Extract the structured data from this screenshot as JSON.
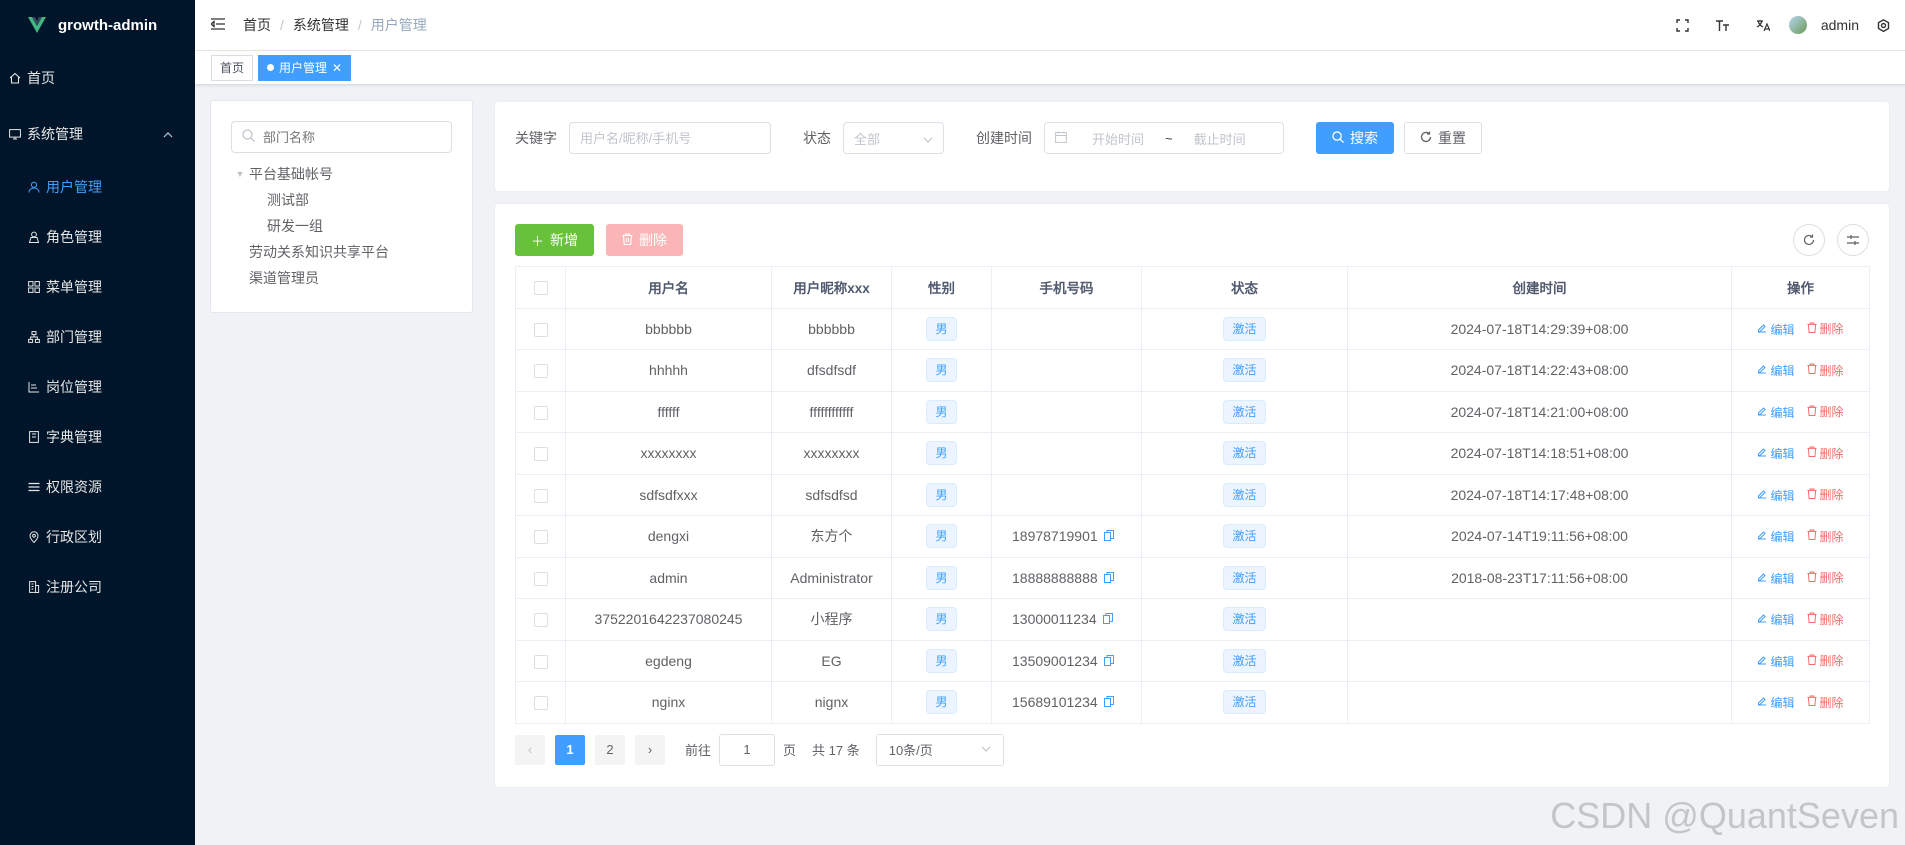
{
  "app": {
    "title": "growth-admin"
  },
  "sidebar": {
    "items": [
      {
        "label": "首页",
        "icon": "home-icon"
      },
      {
        "label": "系统管理",
        "icon": "monitor-icon",
        "expanded": true
      },
      {
        "label": "用户管理",
        "icon": "user-icon",
        "active": true
      },
      {
        "label": "角色管理",
        "icon": "role-icon"
      },
      {
        "label": "菜单管理",
        "icon": "grid-icon"
      },
      {
        "label": "部门管理",
        "icon": "tree-icon"
      },
      {
        "label": "岗位管理",
        "icon": "post-icon"
      },
      {
        "label": "字典管理",
        "icon": "book-icon"
      },
      {
        "label": "权限资源",
        "icon": "list-icon"
      },
      {
        "label": "行政区划",
        "icon": "location-icon"
      },
      {
        "label": "注册公司",
        "icon": "building-icon"
      }
    ]
  },
  "header": {
    "breadcrumb": [
      "首页",
      "系统管理",
      "用户管理"
    ],
    "username": "admin"
  },
  "tags": [
    {
      "label": "首页",
      "active": false
    },
    {
      "label": "用户管理",
      "active": true
    }
  ],
  "dept_tree": {
    "search_placeholder": "部门名称",
    "nodes": [
      {
        "label": "平台基础帐号",
        "level": 0,
        "expanded": true
      },
      {
        "label": "测试部",
        "level": 1
      },
      {
        "label": "研发一组",
        "level": 1
      },
      {
        "label": "劳动关系知识共享平台",
        "level": 0
      },
      {
        "label": "渠道管理员",
        "level": 0
      }
    ]
  },
  "search": {
    "keyword_label": "关键字",
    "keyword_placeholder": "用户名/昵称/手机号",
    "status_label": "状态",
    "status_value": "全部",
    "created_label": "创建时间",
    "start_placeholder": "开始时间",
    "range_sep": "~",
    "end_placeholder": "截止时间",
    "search_btn": "搜索",
    "reset_btn": "重置"
  },
  "toolbar": {
    "add_btn": "新增",
    "delete_btn": "删除"
  },
  "table": {
    "columns": [
      "用户名",
      "用户昵称xxx",
      "性别",
      "手机号码",
      "状态",
      "创建时间",
      "操作"
    ],
    "edit_label": "编辑",
    "delete_label": "删除",
    "rows": [
      {
        "username": "bbbbbb",
        "nickname": "bbbbbb",
        "gender": "男",
        "phone": "",
        "status": "激活",
        "created": "2024-07-18T14:29:39+08:00"
      },
      {
        "username": "hhhhh",
        "nickname": "dfsdfsdf",
        "gender": "男",
        "phone": "",
        "status": "激活",
        "created": "2024-07-18T14:22:43+08:00"
      },
      {
        "username": "ffffff",
        "nickname": "ffffffffffff",
        "gender": "男",
        "phone": "",
        "status": "激活",
        "created": "2024-07-18T14:21:00+08:00"
      },
      {
        "username": "xxxxxxxx",
        "nickname": "xxxxxxxx",
        "gender": "男",
        "phone": "",
        "status": "激活",
        "created": "2024-07-18T14:18:51+08:00"
      },
      {
        "username": "sdfsdfxxx",
        "nickname": "sdfsdfsd",
        "gender": "男",
        "phone": "",
        "status": "激活",
        "created": "2024-07-18T14:17:48+08:00"
      },
      {
        "username": "dengxi",
        "nickname": "东方个",
        "gender": "男",
        "phone": "18978719901",
        "status": "激活",
        "created": "2024-07-14T19:11:56+08:00"
      },
      {
        "username": "admin",
        "nickname": "Administrator",
        "gender": "男",
        "phone": "18888888888",
        "status": "激活",
        "created": "2018-08-23T17:11:56+08:00"
      },
      {
        "username": "3752201642237080245",
        "nickname": "小程序",
        "gender": "男",
        "phone": "13000011234",
        "status": "激活",
        "created": ""
      },
      {
        "username": "egdeng",
        "nickname": "EG",
        "gender": "男",
        "phone": "13509001234",
        "status": "激活",
        "created": ""
      },
      {
        "username": "nginx",
        "nickname": "nignx",
        "gender": "男",
        "phone": "15689101234",
        "status": "激活",
        "created": ""
      }
    ]
  },
  "pagination": {
    "pages": [
      "1",
      "2"
    ],
    "current": "1",
    "goto_label": "前往",
    "goto_value": "1",
    "page_unit": "页",
    "total_text": "共 17 条",
    "page_size": "10条/页"
  },
  "watermark": "CSDN @QuantSeven",
  "colors": {
    "primary": "#409eff",
    "sidebar_bg": "#001529",
    "success": "#67c23a",
    "danger": "#f56c6c"
  }
}
